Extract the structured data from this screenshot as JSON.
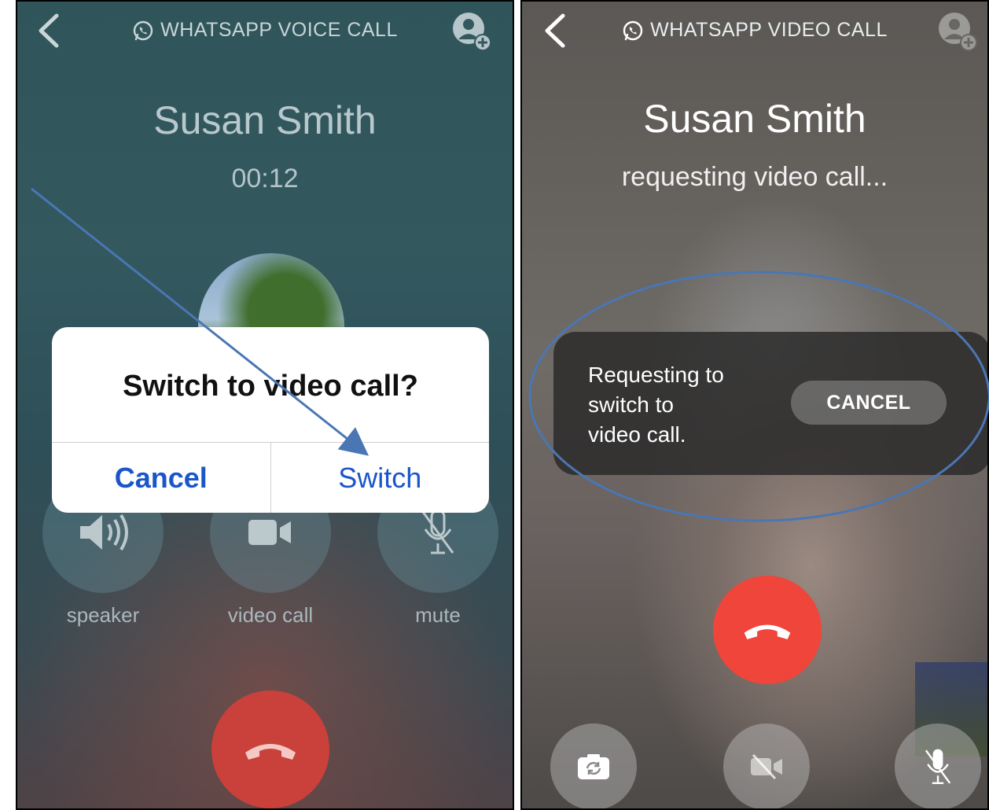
{
  "voice_call_screen": {
    "header_title": "WHATSAPP VOICE CALL",
    "caller_name": "Susan Smith",
    "call_duration": "00:12",
    "controls": [
      {
        "label": "speaker",
        "icon": "speaker-icon"
      },
      {
        "label": "video call",
        "icon": "video-camera-icon"
      },
      {
        "label": "mute",
        "icon": "microphone-muted-icon"
      }
    ],
    "dialog": {
      "title": "Switch to video call?",
      "cancel_label": "Cancel",
      "confirm_label": "Switch"
    },
    "end_call_icon": "phone-hangup-icon"
  },
  "video_call_screen": {
    "header_title": "WHATSAPP VIDEO CALL",
    "caller_name": "Susan Smith",
    "status": "requesting video call...",
    "toast": {
      "line1": "Requesting to",
      "line2": "switch to",
      "line3": "video call.",
      "cancel_label": "CANCEL"
    },
    "bottom_controls": [
      {
        "icon": "switch-camera-icon"
      },
      {
        "icon": "video-off-icon"
      },
      {
        "icon": "microphone-muted-icon"
      }
    ],
    "end_call_icon": "phone-hangup-icon"
  },
  "colors": {
    "end_call_red": "#f0453a",
    "dialog_blue": "#1a56c9",
    "annotation_blue": "#4a76b4"
  }
}
